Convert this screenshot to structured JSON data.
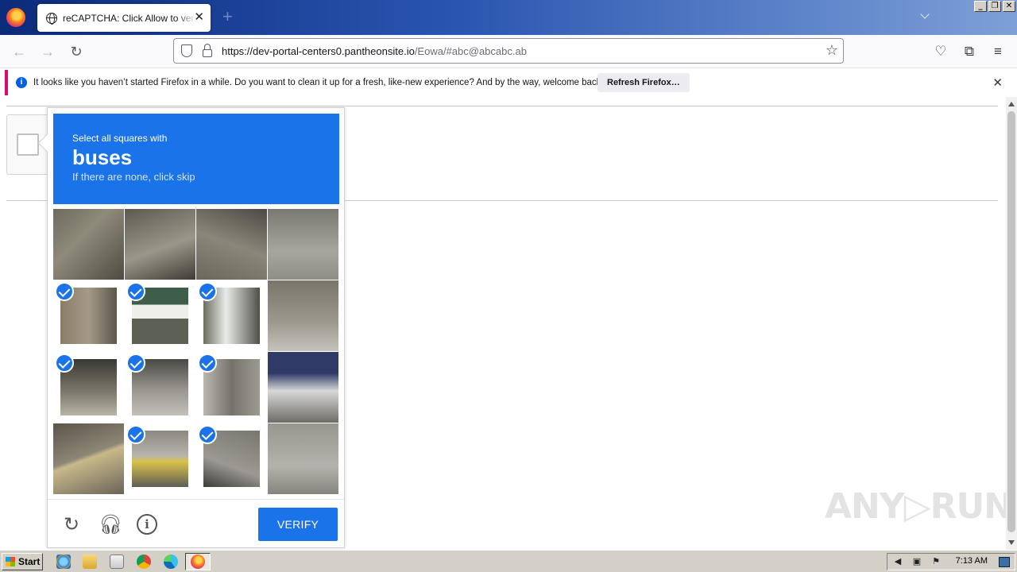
{
  "browser": {
    "tab_title": "reCAPTCHA: Click Allow to verify that you are not a robot",
    "tab_close": "✕",
    "new_tab": "+",
    "window_buttons": [
      "_",
      "❐",
      "✕"
    ],
    "url_host": "https://dev-portal-centers0.pantheonsite.io",
    "url_path": "/Eowa/#abc@abcabc.ab"
  },
  "notification": {
    "message": "It looks like you haven’t started Firefox in a while. Do you want to clean it up for a fresh, like-new experience? And by the way, welcome back!",
    "button": "Refresh Firefox…",
    "close": "✕"
  },
  "captcha": {
    "instruction": "Select all squares with",
    "target": "buses",
    "hint": "If there are none, click skip",
    "verify_label": "VERIFY",
    "tiles": [
      {
        "selected": false
      },
      {
        "selected": false
      },
      {
        "selected": false
      },
      {
        "selected": false
      },
      {
        "selected": true
      },
      {
        "selected": true
      },
      {
        "selected": true
      },
      {
        "selected": false
      },
      {
        "selected": true
      },
      {
        "selected": true
      },
      {
        "selected": true
      },
      {
        "selected": false
      },
      {
        "selected": false
      },
      {
        "selected": true
      },
      {
        "selected": true
      },
      {
        "selected": false
      }
    ],
    "accent_color": "#1a73e8"
  },
  "watermark": "ANY▷RUN",
  "taskbar": {
    "start_label": "Start",
    "clock": "7:13 AM"
  }
}
